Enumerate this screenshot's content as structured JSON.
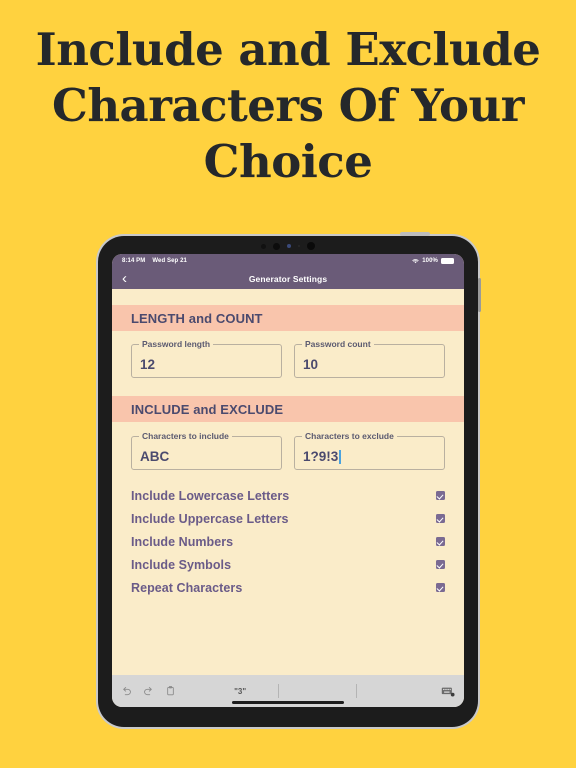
{
  "headline": {
    "text": "Include and Exclude Characters Of Your Choice"
  },
  "colors": {
    "page_background": "#ffd23f",
    "headline_text": "#25282b",
    "navbar": "#6a5b78",
    "screen_background": "#faecc9",
    "section_header": "#f9c5ac",
    "section_header_text": "#4b4a6e",
    "checkbox_fill": "#7a6a92",
    "caret": "#4aa3df",
    "keyboard_toolbar": "#d6d6d6"
  },
  "device": {
    "status_bar": {
      "time": "8:14 PM",
      "date": "Wed Sep 21",
      "battery_percent": "100%",
      "wifi_icon": "wifi-icon",
      "battery_icon": "battery-icon"
    },
    "nav_bar": {
      "back_icon": "chevron-left-icon",
      "title": "Generator Settings"
    }
  },
  "sections": [
    {
      "header": "LENGTH and COUNT",
      "fields": [
        {
          "label": "Password length",
          "value": "12",
          "caret": false
        },
        {
          "label": "Password count",
          "value": "10",
          "caret": false
        }
      ]
    },
    {
      "header": "INCLUDE and EXCLUDE",
      "fields": [
        {
          "label": "Characters to include",
          "value": "ABC",
          "caret": false
        },
        {
          "label": "Characters to exclude",
          "value": "1?9!3",
          "caret": true
        }
      ]
    }
  ],
  "options": [
    {
      "label": "Include Lowercase Letters",
      "checked": true
    },
    {
      "label": "Include Uppercase Letters",
      "checked": true
    },
    {
      "label": "Include Numbers",
      "checked": true
    },
    {
      "label": "Include Symbols",
      "checked": true
    },
    {
      "label": "Repeat Characters",
      "checked": true
    }
  ],
  "keyboard_toolbar": {
    "undo_icon": "undo-icon",
    "redo_icon": "redo-icon",
    "paste_icon": "paste-icon",
    "suggestion": "\"3\"",
    "dismiss_icon": "keyboard-dismiss-icon"
  }
}
